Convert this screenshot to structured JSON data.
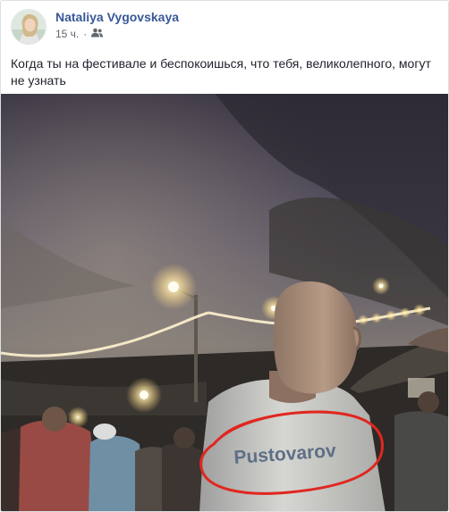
{
  "post": {
    "author": "Nataliya Vygovskaya",
    "timestamp": "15 ч.",
    "separator": "·",
    "audience_icon": "friends-icon",
    "text": "Когда ты на фестивале и беспокоишься, что тебя, великолепного, могут не узнать"
  },
  "photo": {
    "shirt_text": "Pustovarov",
    "highlight_color": "#e0271f",
    "link_color": "#385898"
  }
}
